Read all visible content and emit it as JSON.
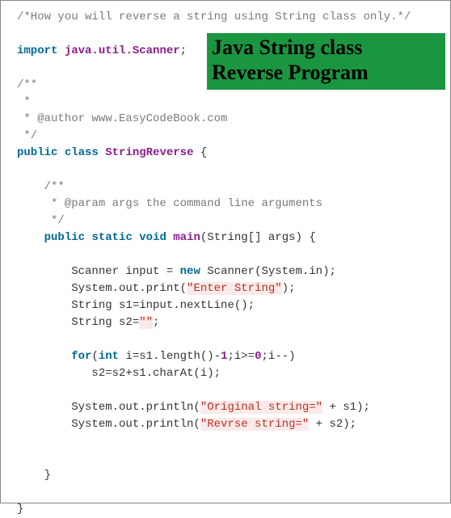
{
  "code": {
    "c1": "/*How you will reverse a string using String class only.*/",
    "kw_import": "import",
    "pkg": "java.util.Scanner",
    "semi": ";",
    "blk_open": "/**",
    "blk_star": " *",
    "author_pre": " * @author ",
    "author_url": "www.EasyCodeBook.com",
    "blk_close": " */",
    "kw_public": "public",
    "kw_class": "class",
    "cls_name": "StringReverse",
    "brace_open": " {",
    "inner_blk_open": "    /**",
    "param_line": "     * @param args the command line arguments",
    "inner_blk_close": "     */",
    "kw_static": "static",
    "kw_void": "void",
    "m_main": "main",
    "main_params": "(String[] args) {",
    "scan_decl": "        Scanner input = ",
    "kw_new": "new",
    "scan_rest": " Scanner(System.in);",
    "print1_pre": "        System.out.print(",
    "str_enter": "\"Enter String\"",
    "print_close": ");",
    "s1_line": "        String s1=input.nextLine();",
    "s2_pre": "        String s2=",
    "str_empty": "\"\"",
    "s2_post": ";",
    "for_kw": "for",
    "for_open": "(",
    "int_kw": "int",
    "for_body1": " i=s1.length()-",
    "num_1": "1",
    "for_body2": ";i>=",
    "num_0": "0",
    "for_body3": ";i--)",
    "for_inner": "           s2=s2+s1.charAt(i);",
    "println1_pre": "        System.out.println(",
    "str_orig": "\"Original string=\"",
    "plus_s1": " + s1);",
    "println2_pre": "        System.out.println(",
    "str_rev": "\"Revrse string=\"",
    "plus_s2": " + s2);",
    "brace_close_m": "    }",
    "brace_close_c": "}"
  },
  "banner": {
    "line1": "Java String class",
    "line2": "Reverse Program"
  }
}
